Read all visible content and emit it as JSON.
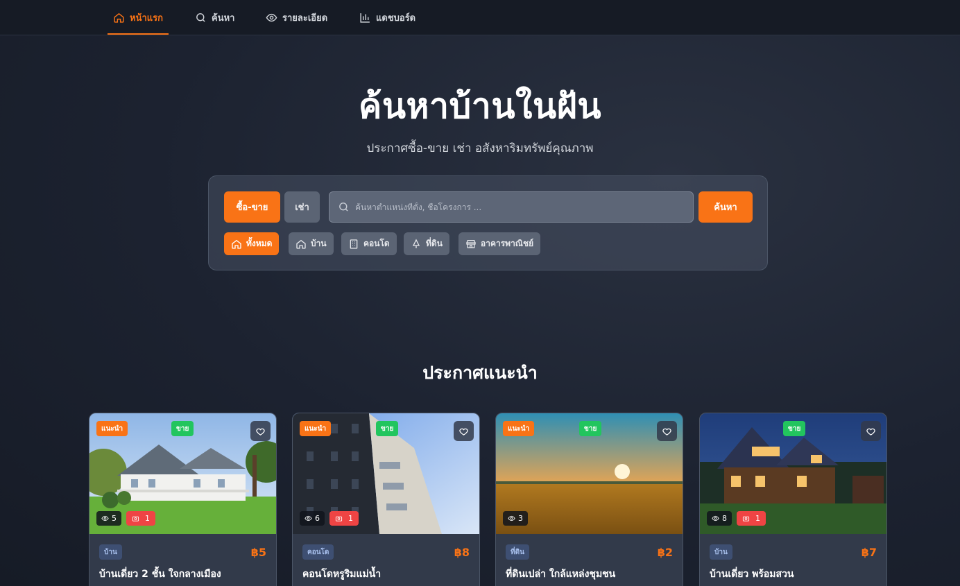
{
  "nav": {
    "items": [
      {
        "label": "หน้าแรก",
        "icon": "home-icon",
        "active": true
      },
      {
        "label": "ค้นหา",
        "icon": "search-icon",
        "active": false
      },
      {
        "label": "รายละเอียด",
        "icon": "eye-icon",
        "active": false
      },
      {
        "label": "แดชบอร์ด",
        "icon": "bar-chart-icon",
        "active": false
      }
    ]
  },
  "hero": {
    "title": "ค้นหาบ้านในฝัน",
    "subtitle": "ประกาศซื้อ-ขาย เช่า อสังหาริมทรัพย์คุณภาพ"
  },
  "search": {
    "mode_buy_sell": "ซื้อ-ขาย",
    "mode_rent": "เช่า",
    "placeholder": "ค้นหาตำแหน่งที่ตั้ง, ชื่อโครงการ ...",
    "value": "",
    "submit_label": "ค้นหา",
    "categories": [
      {
        "label": "ทั้งหมด",
        "icon": "home-icon",
        "active": true
      },
      {
        "label": "บ้าน",
        "icon": "home-icon",
        "active": false
      },
      {
        "label": "คอนโด",
        "icon": "building-icon",
        "active": false
      },
      {
        "label": "ที่ดิน",
        "icon": "tree-icon",
        "active": false
      },
      {
        "label": "อาคารพาณิชย์",
        "icon": "store-icon",
        "active": false
      }
    ]
  },
  "featured": {
    "title": "ประกาศแนะนำ",
    "cards": [
      {
        "recommended": "แนะนำ",
        "status": "ขาย",
        "views": "5",
        "photos": "1",
        "type": "บ้าน",
        "price": "฿5",
        "title": "บ้านเดี่ยว 2 ชั้น ใจกลางเมือง",
        "image": "house-photo"
      },
      {
        "recommended": "แนะนำ",
        "status": "ขาย",
        "views": "6",
        "photos": "1",
        "type": "คอนโด",
        "price": "฿8",
        "title": "คอนโดหรูริมแม่น้ำ",
        "image": "condo-photo"
      },
      {
        "recommended": "แนะนำ",
        "status": "ขาย",
        "views": "3",
        "photos": "",
        "type": "ที่ดิน",
        "price": "฿2",
        "title": "ที่ดินเปล่า ใกล้แหล่งชุมชน",
        "image": "land-photo"
      },
      {
        "recommended": "",
        "status": "ขาย",
        "views": "8",
        "photos": "1",
        "type": "บ้าน",
        "price": "฿7",
        "title": "บ้านเดี่ยว พร้อมสวน",
        "image": "house-night-photo"
      }
    ]
  },
  "colors": {
    "accent": "#f97316",
    "sale": "#22c55e",
    "photos_badge": "#ef4444",
    "background": "#1c2230"
  }
}
